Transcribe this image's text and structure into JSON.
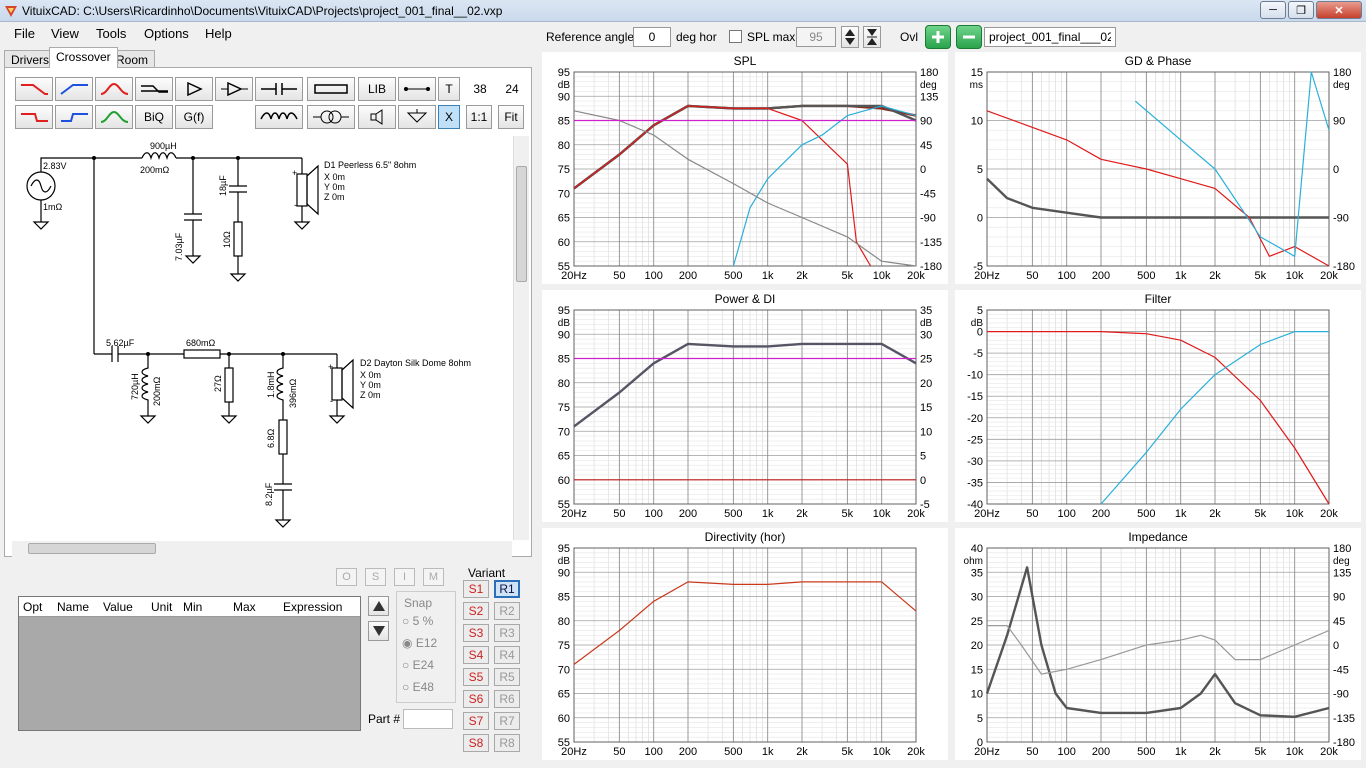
{
  "window": {
    "title": "VituixCAD: C:\\Users\\Ricardinho\\Documents\\VituixCAD\\Projects\\project_001_final__02.vxp"
  },
  "menu": [
    "File",
    "View",
    "Tools",
    "Options",
    "Help"
  ],
  "tabs": [
    "Drivers",
    "Crossover",
    "Room"
  ],
  "toolbar": {
    "lib": "LIB",
    "t": "T",
    "n38": "38",
    "n24": "24",
    "biq": "BiQ",
    "gf": "G(f)",
    "x": "X",
    "ratio": "1:1",
    "fit": "Fit"
  },
  "schematic": {
    "source_v": "2.83V",
    "source_r": "1mΩ",
    "l1": "900µH",
    "l1r": "200mΩ",
    "c1": "7.03µF",
    "c2": "18µF",
    "r1": "10Ω",
    "d1": "D1 Peerless 6.5\" 8ohm",
    "d1x": "X 0m",
    "d1y": "Y 0m",
    "d1z": "Z 0m",
    "c3": "5.62µF",
    "r2": "680mΩ",
    "l2": "720µH",
    "l2r": "200mΩ",
    "r3": "27Ω",
    "l3": "1.8mH",
    "l3r": "396mΩ",
    "r4": "6.8Ω",
    "c4": "8.2µF",
    "d2": "D2 Dayton Silk Dome 8ohm",
    "d2x": "X 0m",
    "d2y": "Y 0m",
    "d2z": "Z 0m",
    "plus": "+",
    "minus": "-"
  },
  "optimizer": {
    "buttons": [
      "O",
      "S",
      "I",
      "M"
    ],
    "columns": [
      "Opt",
      "Name",
      "Value",
      "Unit",
      "Min",
      "Max",
      "Expression"
    ],
    "snap_label": "Snap",
    "snap_options": [
      "5 %",
      "E12",
      "E24",
      "E48"
    ],
    "part_label": "Part #"
  },
  "variant": {
    "label": "Variant",
    "s": [
      "S1",
      "S2",
      "S3",
      "S4",
      "S5",
      "S6",
      "S7",
      "S8"
    ],
    "r": [
      "R1",
      "R2",
      "R3",
      "R4",
      "R5",
      "R6",
      "R7",
      "R8"
    ]
  },
  "controls": {
    "ref_angle_label": "Reference angle",
    "ref_angle_value": "0",
    "deg_hor": "deg hor",
    "spl_max_label": "SPL max",
    "spl_max_value": "95",
    "ovl": "Ovl",
    "project_name": "project_001_final___02"
  },
  "chart_data": [
    {
      "name": "SPL",
      "type": "line",
      "title": "SPL",
      "x_ticks": [
        "20Hz",
        "50",
        "100",
        "200",
        "500",
        "1k",
        "2k",
        "5k",
        "10k",
        "20k"
      ],
      "y_unit": "dB",
      "y_ticks": [
        "95",
        "90",
        "85",
        "80",
        "75",
        "70",
        "65",
        "60",
        "55"
      ],
      "y2_unit": "deg",
      "y2_ticks": [
        "180",
        "135",
        "90",
        "45",
        "0",
        "-45",
        "-90",
        "-135",
        "-180"
      ],
      "series": [
        {
          "color": "#8b2b1e",
          "x": [
            20,
            50,
            100,
            200,
            500,
            1000,
            2000,
            5000,
            10000,
            20000
          ],
          "y": [
            71,
            78,
            84,
            88,
            87.5,
            87.5,
            88,
            88,
            87.5,
            86
          ]
        },
        {
          "color": "#555555",
          "x": [
            20,
            50,
            100,
            200,
            500,
            1000,
            2000,
            5000,
            10000,
            20000
          ],
          "y": [
            71,
            78,
            84,
            88,
            87.5,
            87.5,
            88,
            88,
            88,
            85
          ]
        },
        {
          "color": "#e01a1a",
          "x": [
            20,
            50,
            100,
            200,
            500,
            1000,
            2000,
            3000,
            5000,
            6000,
            8000
          ],
          "y": [
            71,
            78,
            84,
            88,
            87.5,
            87.5,
            85,
            81,
            76,
            60,
            55
          ]
        },
        {
          "color": "#2ab0d8",
          "x": [
            500,
            700,
            1000,
            2000,
            3000,
            5000,
            10000,
            20000
          ],
          "y": [
            55,
            67,
            73,
            80,
            82,
            86,
            88,
            86
          ]
        },
        {
          "color": "#888888",
          "x": [
            20,
            50,
            100,
            200,
            500,
            1000,
            2000,
            5000,
            10000,
            20000
          ],
          "y": [
            87,
            85,
            82,
            77,
            72,
            68,
            65,
            61,
            56,
            55
          ]
        },
        {
          "color": "#cc22cc",
          "x": [
            20,
            20000
          ],
          "y": [
            85,
            85
          ]
        }
      ]
    },
    {
      "name": "GD & Phase",
      "type": "line",
      "title": "GD & Phase",
      "x_ticks": [
        "20Hz",
        "50",
        "100",
        "200",
        "500",
        "1k",
        "2k",
        "5k",
        "10k",
        "20k"
      ],
      "y_unit": "ms",
      "y_ticks": [
        "15",
        "10",
        "5",
        "0",
        "-5"
      ],
      "y2_unit": "deg",
      "y2_ticks": [
        "180",
        "90",
        "0",
        "-90",
        "-180"
      ],
      "series": [
        {
          "color": "#555555",
          "x": [
            20,
            30,
            50,
            100,
            200,
            500,
            1000,
            5000,
            10000,
            20000
          ],
          "y": [
            4,
            2,
            1,
            0.5,
            0,
            0,
            0,
            0,
            0,
            0
          ]
        },
        {
          "color": "#e01a1a",
          "x": [
            20,
            100,
            200,
            500,
            1000,
            2000,
            4000,
            6000,
            10000,
            20000
          ],
          "y": [
            11,
            8,
            6,
            5,
            4,
            3,
            0,
            -4,
            -3,
            -5
          ]
        },
        {
          "color": "#2ab0d8",
          "x": [
            400,
            1000,
            2000,
            5000,
            10000,
            14000,
            20000
          ],
          "y": [
            12,
            8,
            5,
            -2,
            -4,
            15,
            9
          ]
        }
      ]
    },
    {
      "name": "Power & DI",
      "type": "line",
      "title": "Power & DI",
      "x_ticks": [
        "20Hz",
        "50",
        "100",
        "200",
        "500",
        "1k",
        "2k",
        "5k",
        "10k",
        "20k"
      ],
      "y_unit": "dB",
      "y_ticks": [
        "95",
        "90",
        "85",
        "80",
        "75",
        "70",
        "65",
        "60",
        "55"
      ],
      "y2_unit": "dB",
      "y2_ticks": [
        "35",
        "30",
        "25",
        "20",
        "15",
        "10",
        "5",
        "0",
        "-5"
      ],
      "series": [
        {
          "color": "#555566",
          "x": [
            20,
            50,
            100,
            200,
            500,
            1000,
            2000,
            5000,
            10000,
            20000
          ],
          "y": [
            71,
            78,
            84,
            88,
            87.5,
            87.5,
            88,
            88,
            88,
            84
          ]
        },
        {
          "color": "#cc22cc",
          "x": [
            20,
            20000
          ],
          "y": [
            85,
            85
          ]
        },
        {
          "color": "#c01a1a",
          "x": [
            20,
            20000
          ],
          "y": [
            60,
            60
          ]
        }
      ]
    },
    {
      "name": "Filter",
      "type": "line",
      "title": "Filter",
      "x_ticks": [
        "20Hz",
        "50",
        "100",
        "200",
        "500",
        "1k",
        "2k",
        "5k",
        "10k",
        "20k"
      ],
      "y_unit": "dB",
      "y_ticks": [
        "5",
        "0",
        "-5",
        "-10",
        "-15",
        "-20",
        "-25",
        "-30",
        "-35",
        "-40"
      ],
      "series": [
        {
          "color": "#e01a1a",
          "x": [
            20,
            100,
            200,
            500,
            1000,
            2000,
            5000,
            10000,
            20000
          ],
          "y": [
            0,
            0,
            0,
            -0.5,
            -2,
            -6,
            -16,
            -27,
            -40
          ]
        },
        {
          "color": "#2ab0d8",
          "x": [
            200,
            500,
            1000,
            2000,
            5000,
            10000,
            20000
          ],
          "y": [
            -40,
            -28,
            -18,
            -10,
            -3,
            0,
            0
          ]
        }
      ]
    },
    {
      "name": "Directivity (hor)",
      "type": "line",
      "title": "Directivity (hor)",
      "x_ticks": [
        "20Hz",
        "50",
        "100",
        "200",
        "500",
        "1k",
        "2k",
        "5k",
        "10k",
        "20k"
      ],
      "y_unit": "dB",
      "y_ticks": [
        "95",
        "90",
        "85",
        "80",
        "75",
        "70",
        "65",
        "60",
        "55"
      ],
      "series": [
        {
          "color": "#c8381a",
          "x": [
            20,
            50,
            100,
            200,
            500,
            1000,
            2000,
            5000,
            10000,
            20000
          ],
          "y": [
            71,
            78,
            84,
            88,
            87.5,
            87.5,
            88,
            88,
            88,
            82
          ]
        }
      ]
    },
    {
      "name": "Impedance",
      "type": "line",
      "title": "Impedance",
      "x_ticks": [
        "20Hz",
        "50",
        "100",
        "200",
        "500",
        "1k",
        "2k",
        "5k",
        "10k",
        "20k"
      ],
      "y_unit": "ohm",
      "y_ticks": [
        "40",
        "35",
        "30",
        "25",
        "20",
        "15",
        "10",
        "5",
        "0"
      ],
      "y2_unit": "deg",
      "y2_ticks": [
        "180",
        "135",
        "90",
        "45",
        "0",
        "-45",
        "-90",
        "-135",
        "-180"
      ],
      "series": [
        {
          "color": "#555555",
          "x": [
            20,
            30,
            45,
            60,
            80,
            100,
            200,
            500,
            1000,
            1500,
            2000,
            3000,
            5000,
            10000,
            20000
          ],
          "y": [
            10,
            22,
            36,
            20,
            10,
            7,
            6,
            6,
            7,
            10,
            14,
            8,
            5.5,
            5.2,
            7
          ]
        },
        {
          "color": "#999999",
          "x": [
            20,
            30,
            40,
            60,
            100,
            200,
            500,
            1000,
            1500,
            2000,
            3000,
            5000,
            10000,
            20000
          ],
          "y": [
            24,
            24,
            20,
            14,
            15,
            17,
            20,
            21,
            22,
            21,
            17,
            17,
            20,
            23
          ]
        }
      ]
    }
  ]
}
